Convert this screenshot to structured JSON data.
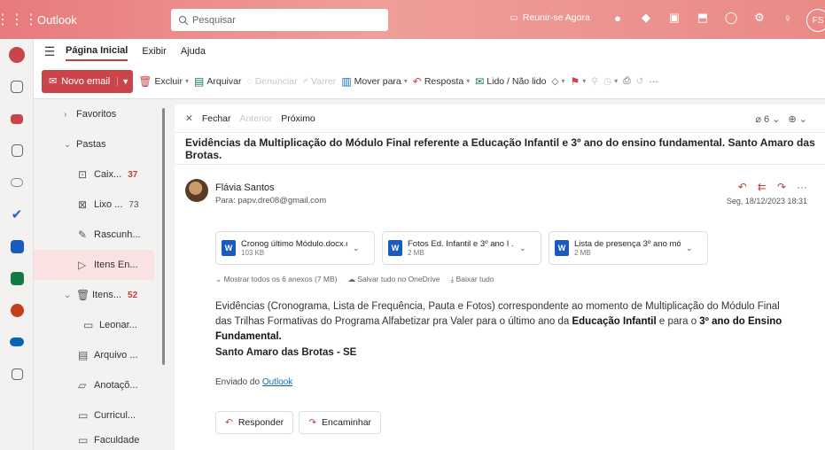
{
  "app": {
    "name": "Outlook",
    "avatar_initials": "FS"
  },
  "search": {
    "placeholder": "Pesquisar"
  },
  "meet": {
    "label": "Reunir-se Agora"
  },
  "ribbon": {
    "tabs": [
      "Página Inicial",
      "Exibir",
      "Ajuda"
    ]
  },
  "toolbar": {
    "new_email": "Novo email",
    "delete": "Excluir",
    "archive": "Arquivar",
    "report": "Denunciar",
    "sweep": "Varrer",
    "move": "Mover para",
    "reply": "Resposta",
    "read_unread": "Lido / Não lido"
  },
  "folders": [
    {
      "label": "Favoritos",
      "type": "section",
      "expanded": false
    },
    {
      "label": "Pastas",
      "type": "section",
      "expanded": true
    },
    {
      "label": "Caix...",
      "count": "37",
      "icon": "inbox-icon"
    },
    {
      "label": "Lixo ...",
      "count": "73",
      "icon": "junk-icon"
    },
    {
      "label": "Rascunh...",
      "count": "",
      "icon": "drafts-icon"
    },
    {
      "label": "Itens En...",
      "count": "",
      "icon": "sent-icon",
      "selected": true
    },
    {
      "label": "Itens...",
      "count": "52",
      "icon": "trash-icon"
    },
    {
      "label": "Leonar...",
      "count": "",
      "icon": "folder-icon"
    },
    {
      "label": "Arquivo ...",
      "count": "",
      "icon": "archive-icon"
    },
    {
      "label": "Anotaçõ...",
      "count": "",
      "icon": "notes-icon"
    },
    {
      "label": "Curricul...",
      "count": "",
      "icon": "folder-icon"
    },
    {
      "label": "Faculdade",
      "count": "",
      "icon": "folder-icon"
    }
  ],
  "reading": {
    "close": "Fechar",
    "previous": "Anterior",
    "next": "Próximo",
    "attachments_count": "6",
    "subject": "Evidências da Multiplicação do Módulo Final referente a Educação Infantil e 3º ano do ensino fundamental. Santo Amaro das Brotas.",
    "sender_name": "Flávia Santos",
    "to": "Para:  papv.dre08@gmail.com",
    "date": "Seg, 18/12/2023 18:31",
    "attachments": [
      {
        "name": "Cronog último Módulo.docx.d...",
        "size": "103 KB"
      },
      {
        "name": "Fotos Ed. Infantil e 3º ano I ...",
        "size": "2 MB"
      },
      {
        "name": "Lista de presença 3º ano mó...",
        "size": "2 MB"
      }
    ],
    "show_all": "Mostrar todos os 6 anexos (7 MB)",
    "save_onedrive": "Salvar tudo no OneDrive",
    "download_all": "Baixar tudo",
    "body_part1": "Evidências (Cronograma, Lista de Frequência, Pauta e Fotos) correspondente ao momento de Multiplicação do Módulo Final das Trilhas Formativas do Programa Alfabetizar pra Valer para o último ano da ",
    "body_bold1": "Educação Infantil",
    "body_part2": " e para o ",
    "body_bold2": "3º ano do Ensino Fundamental.",
    "signature": "Santo Amaro das Brotas - SE",
    "sent_from_prefix": "Enviado do ",
    "sent_from_link": "Outlook",
    "reply_btn": "Responder",
    "forward_btn": "Encaminhar"
  },
  "colors": {
    "accent": "#c9454a",
    "header_gradient_start": "#e87a7c"
  }
}
